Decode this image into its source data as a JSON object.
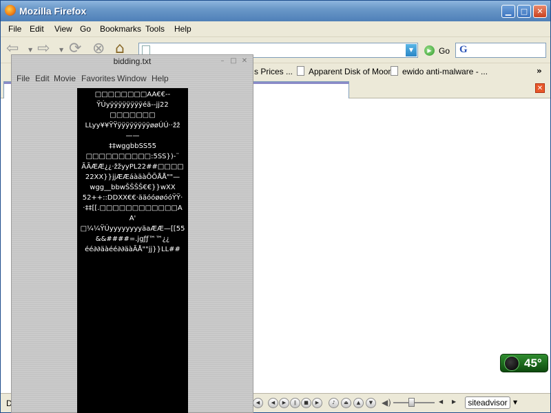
{
  "firefox": {
    "title": "Mozilla Firefox",
    "menu": [
      "File",
      "Edit",
      "View",
      "Go",
      "Bookmarks",
      "Tools",
      "Help"
    ],
    "go_label": "Go",
    "search_engine_glyph": "G",
    "bookmarks": [
      "s Prices ...",
      "Apparent Disk of Moon",
      "ewido anti-malware - ..."
    ],
    "bookmarks_more": "»",
    "status_text": "D",
    "siteadvisor": "siteadvisor"
  },
  "weather": {
    "temperature": "45°"
  },
  "player": {
    "title": "bidding.txt",
    "menu": [
      "File",
      "Edit",
      "Movie",
      "Favorites",
      "Window",
      "Help"
    ],
    "screen_text": "□□□□□□□□AA€€-‐\nŸÚyÿÿÿÿÿÿÿÿéä--jj22\n□□□□□□□\nLLyy¥¥ŸŸÿÿÿÿÿÿÿÿøøÚÚ··žž——\n‡‡wggbbSS55\n□□□□□□□□□□:5SS})-¨\nÃÃÆÆ¿¿·žžyyPL22##□□□□\n22XX}}jjÆÆáàäàÕÕÅÅ\"\"—\nwgg__bbwŠŠŠŠ€€}}wXX\n52++::DDXX€€·ääóóøøóóŸŸ·\n·‡‡[[.□□□□□□□□□□□□AA'\n□¼¼ŸÚyyyyyyyyäaÆÆ—[[55\n&&####=.jgƒƒ™™¿¿\néé∂∂äàéé∂∂äàÃÅ\"\"jj}}LL##"
  }
}
